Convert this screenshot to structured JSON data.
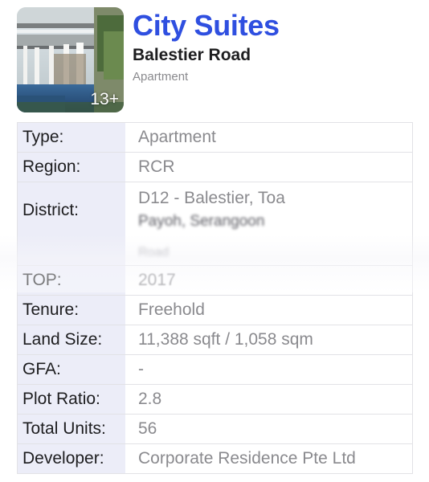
{
  "property": {
    "name": "City Suites",
    "street": "Balestier Road",
    "type": "Apartment",
    "photo_count": "13+"
  },
  "details": [
    {
      "label": "Type:",
      "value": "Apartment"
    },
    {
      "label": "Region:",
      "value": "RCR"
    },
    {
      "label": "District:",
      "value": "D12 - Balestier, Toa",
      "value_line2": "Payoh, Serangoon",
      "value_line3": "Road"
    },
    {
      "label": "TOP:",
      "value": "2017"
    },
    {
      "label": "Tenure:",
      "value": "Freehold"
    },
    {
      "label": "Land Size:",
      "value": "11,388 sqft / 1,058 sqm"
    },
    {
      "label": "GFA:",
      "value": "-"
    },
    {
      "label": "Plot Ratio:",
      "value": "2.8"
    },
    {
      "label": "Total Units:",
      "value": "56"
    },
    {
      "label": "Developer:",
      "value": "Corporate Residence Pte Ltd"
    }
  ],
  "colors": {
    "title": "#2f4fe0",
    "label_bg": "#ecedf8",
    "value_text": "#8a8a8e",
    "border": "#e2e2e6"
  }
}
